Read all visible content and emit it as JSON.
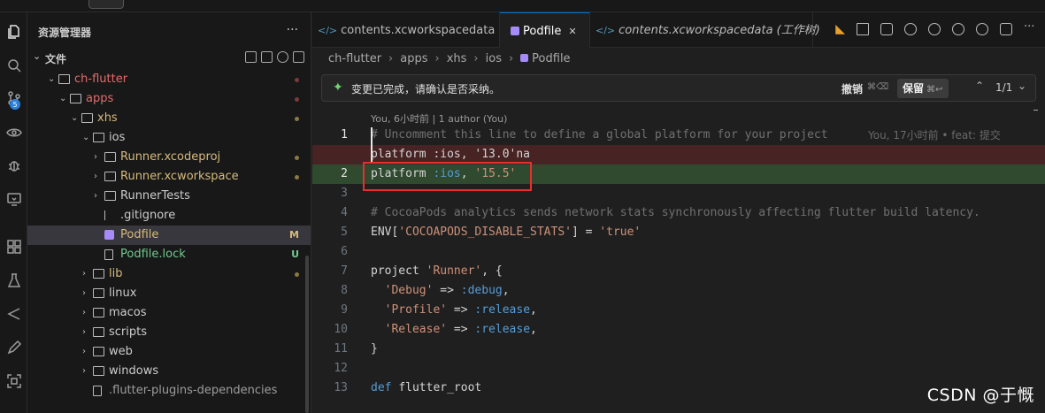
{
  "sidebar": {
    "title": "资源管理器",
    "more": "···",
    "section": "文件",
    "tree": [
      {
        "name": "ch-flutter",
        "indent": 1,
        "kind": "folder",
        "open": true,
        "color": "#e06c6c"
      },
      {
        "name": "apps",
        "indent": 2,
        "kind": "folder",
        "open": true,
        "color": "#e06c6c"
      },
      {
        "name": "xhs",
        "indent": 3,
        "kind": "folder",
        "open": true,
        "color": "#d7ba7d"
      },
      {
        "name": "ios",
        "indent": 4,
        "kind": "folder",
        "open": true,
        "color": "#cccccc"
      },
      {
        "name": "Runner.xcodeproj",
        "indent": 5,
        "kind": "folder",
        "open": false,
        "color": "#d7ba7d"
      },
      {
        "name": "Runner.xcworkspace",
        "indent": 5,
        "kind": "folder",
        "open": false,
        "color": "#d7ba7d"
      },
      {
        "name": "RunnerTests",
        "indent": 5,
        "kind": "folder",
        "open": false,
        "color": "#cccccc"
      },
      {
        "name": ".gitignore",
        "indent": 5,
        "kind": "git",
        "color": "#cccccc"
      },
      {
        "name": "Podfile",
        "indent": 5,
        "kind": "pod",
        "color": "#d7ba7d",
        "status": "M"
      },
      {
        "name": "Podfile.lock",
        "indent": 5,
        "kind": "file",
        "color": "#73c991",
        "status": "U"
      },
      {
        "name": "lib",
        "indent": 4,
        "kind": "folder",
        "open": false,
        "color": "#d7ba7d"
      },
      {
        "name": "linux",
        "indent": 4,
        "kind": "folder",
        "open": false,
        "color": "#cccccc"
      },
      {
        "name": "macos",
        "indent": 4,
        "kind": "folder",
        "open": false,
        "color": "#cccccc"
      },
      {
        "name": "scripts",
        "indent": 4,
        "kind": "folder",
        "open": false,
        "color": "#cccccc"
      },
      {
        "name": "web",
        "indent": 4,
        "kind": "folder",
        "open": false,
        "color": "#cccccc"
      },
      {
        "name": "windows",
        "indent": 4,
        "kind": "folder",
        "open": false,
        "color": "#cccccc"
      },
      {
        "name": ".flutter-plugins-dependencies",
        "indent": 4,
        "kind": "file",
        "color": "#9d9d9d"
      }
    ]
  },
  "tabs": [
    {
      "label": "contents.xcworkspacedata",
      "icon": "</>",
      "active": false,
      "italic": false
    },
    {
      "label": "Podfile",
      "icon": "pod",
      "active": true,
      "italic": false
    },
    {
      "label": "contents.xcworkspacedata (工作树)",
      "icon": "</>",
      "active": false,
      "italic": true
    }
  ],
  "breadcrumb": [
    "ch-flutter",
    "apps",
    "xhs",
    "ios",
    "Podfile"
  ],
  "notification": {
    "message": "变更已完成，请确认是否采纳。",
    "undo": "撤销",
    "undo_key": "⌘⌫",
    "keep": "保留",
    "keep_key": "⌘↩",
    "count": "1/1"
  },
  "codelens": "You, 6小时前 | 1 author (You)",
  "code": [
    {
      "ln": "1",
      "cur": true,
      "type": "normal",
      "parts": [
        {
          "t": "# Uncomment this line to define a global platform for your project",
          "c": "c-com faded"
        }
      ],
      "blame": "You, 17小时前 • feat: 提交"
    },
    {
      "ln": "",
      "type": "del",
      "parts": [
        {
          "t": "platform :ios, '13.0'na",
          "c": "c-def"
        }
      ]
    },
    {
      "ln": "2",
      "cur": true,
      "type": "add",
      "parts": [
        {
          "t": "platform ",
          "c": "c-def"
        },
        {
          "t": ":ios",
          "c": "c-sym"
        },
        {
          "t": ", ",
          "c": "c-def"
        },
        {
          "t": "'15.5'",
          "c": "c-str"
        }
      ]
    },
    {
      "ln": "3",
      "type": "normal",
      "parts": []
    },
    {
      "ln": "4",
      "type": "normal",
      "parts": [
        {
          "t": "# CocoaPods analytics sends network stats synchronously affecting flutter build latency.",
          "c": "c-com faded"
        }
      ]
    },
    {
      "ln": "5",
      "type": "normal",
      "parts": [
        {
          "t": "ENV[",
          "c": "c-def"
        },
        {
          "t": "'COCOAPODS_DISABLE_STATS'",
          "c": "c-str"
        },
        {
          "t": "] = ",
          "c": "c-def"
        },
        {
          "t": "'true'",
          "c": "c-str"
        }
      ]
    },
    {
      "ln": "6",
      "type": "normal",
      "parts": []
    },
    {
      "ln": "7",
      "type": "normal",
      "parts": [
        {
          "t": "project ",
          "c": "c-def"
        },
        {
          "t": "'Runner'",
          "c": "c-str"
        },
        {
          "t": ", {",
          "c": "c-def"
        }
      ]
    },
    {
      "ln": "8",
      "type": "normal",
      "parts": [
        {
          "t": "  ",
          "c": "c-def"
        },
        {
          "t": "'Debug'",
          "c": "c-str"
        },
        {
          "t": " => ",
          "c": "c-def"
        },
        {
          "t": ":debug",
          "c": "c-sym"
        },
        {
          "t": ",",
          "c": "c-def"
        }
      ]
    },
    {
      "ln": "9",
      "type": "normal",
      "parts": [
        {
          "t": "  ",
          "c": "c-def"
        },
        {
          "t": "'Profile'",
          "c": "c-str"
        },
        {
          "t": " => ",
          "c": "c-def"
        },
        {
          "t": ":release",
          "c": "c-sym"
        },
        {
          "t": ",",
          "c": "c-def"
        }
      ]
    },
    {
      "ln": "10",
      "type": "normal",
      "parts": [
        {
          "t": "  ",
          "c": "c-def"
        },
        {
          "t": "'Release'",
          "c": "c-str"
        },
        {
          "t": " => ",
          "c": "c-def"
        },
        {
          "t": ":release",
          "c": "c-sym"
        },
        {
          "t": ",",
          "c": "c-def"
        }
      ]
    },
    {
      "ln": "11",
      "type": "normal",
      "parts": [
        {
          "t": "}",
          "c": "c-def"
        }
      ]
    },
    {
      "ln": "12",
      "type": "normal",
      "parts": []
    },
    {
      "ln": "13",
      "type": "normal",
      "parts": [
        {
          "t": "def ",
          "c": "c-kw"
        },
        {
          "t": "flutter_root",
          "c": "c-def"
        }
      ]
    }
  ],
  "watermark": "CSDN @于慨",
  "colors": {
    "accent": "#0078d4",
    "added": "#73c991",
    "modified": "#d7ba7d",
    "highlight_box": "#e82f2f"
  }
}
